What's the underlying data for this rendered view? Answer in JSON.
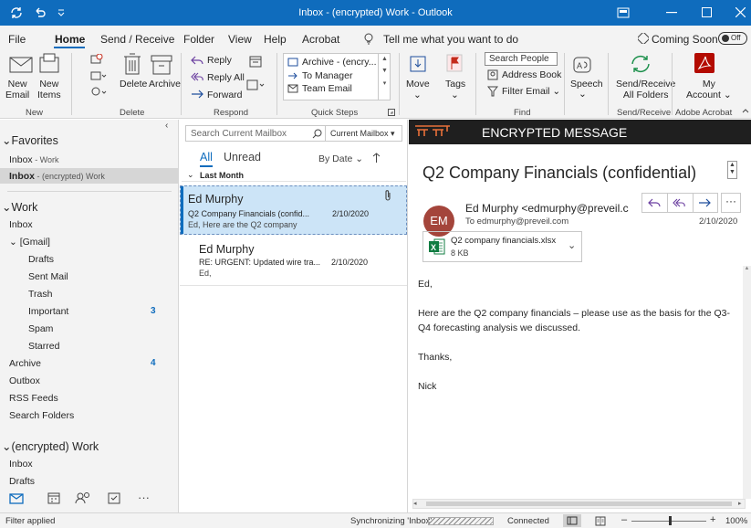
{
  "titlebar": {
    "title": "Inbox - (encrypted) Work - Outlook"
  },
  "tabs": [
    "File",
    "Home",
    "Send / Receive",
    "Folder",
    "View",
    "Help",
    "Acrobat"
  ],
  "tellme": "Tell me what you want to do",
  "coming_soon": "Coming Soon",
  "toggle": "Off",
  "ribbon": {
    "new_email": "New\nEmail",
    "new_items": "New\nItems",
    "delete": "Delete",
    "archive": "Archive",
    "reply": "Reply",
    "reply_all": "Reply All",
    "forward": "Forward",
    "qs1": "Archive - (encry...",
    "qs2": "To Manager",
    "qs3": "Team Email",
    "move": "Move",
    "tags": "Tags",
    "search_people": "Search People",
    "address_book": "Address Book",
    "filter_email": "Filter Email",
    "speech": "Speech",
    "send_receive": "Send/Receive\nAll Folders",
    "my_account": "My\nAccount",
    "groups": [
      "New",
      "Delete",
      "Respond",
      "Quick Steps",
      "Move",
      "Tags",
      "Find",
      "Send/Receive",
      "Adobe Acrobat"
    ]
  },
  "folders": {
    "favorites": "Favorites",
    "fav_items": [
      "Inbox - Work",
      "Inbox - (encrypted) Work"
    ],
    "work": "Work",
    "work_inbox": "Inbox",
    "gmail": "[Gmail]",
    "gmail_items": [
      "Drafts",
      "Sent Mail",
      "Trash",
      "Important",
      "Spam",
      "Starred"
    ],
    "important_count": "3",
    "other": [
      "Archive",
      "Outbox",
      "RSS Feeds",
      "Search Folders"
    ],
    "archive_count": "4",
    "enc": "(encrypted) Work",
    "enc_items": [
      "Inbox",
      "Drafts"
    ]
  },
  "list": {
    "search_placeholder": "Search Current Mailbox",
    "scope": "Current Mailbox",
    "all": "All",
    "unread": "Unread",
    "sort": "By Date",
    "group": "Last Month",
    "items": [
      {
        "from": "Ed Murphy",
        "subject": "Q2 Company Financials (confid...",
        "date": "2/10/2020",
        "preview": "Ed,  Here are the Q2 company"
      },
      {
        "from": "Ed Murphy",
        "subject": "RE: URGENT: Updated wire tra...",
        "date": "2/10/2020",
        "preview": "Ed,"
      }
    ]
  },
  "reading": {
    "banner": "ENCRYPTED MESSAGE",
    "subject": "Q2 Company Financials (confidential)",
    "avatar": "EM",
    "from": "Ed Murphy <edmurphy@preveil.c",
    "to": "To  edmurphy@preveil.com",
    "date": "2/10/2020",
    "attachment": "Q2 company financials.xlsx",
    "attachment_size": "8 KB",
    "body": [
      "Ed,",
      "Here are the Q2 company financials – please use as the basis for the Q3-Q4 forecasting analysis we discussed.",
      "Thanks,",
      "Nick"
    ]
  },
  "status": {
    "left": "Filter applied",
    "sync": "Synchronizing  'Inbox'",
    "connected": "Connected",
    "zoom": "100%"
  }
}
